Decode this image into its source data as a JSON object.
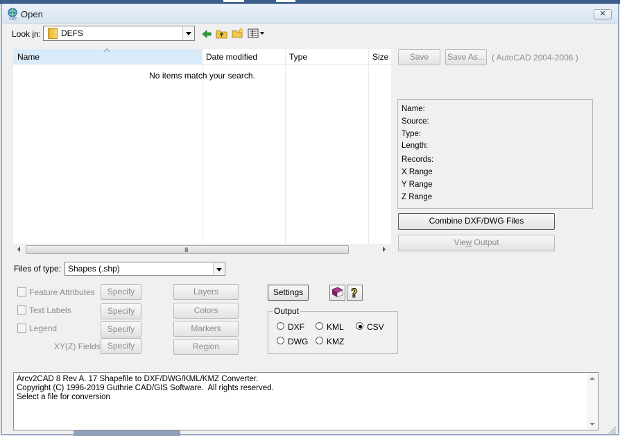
{
  "window": {
    "title": "Open",
    "close_symbol": "✕"
  },
  "look_in": {
    "label": "Look in:",
    "value": "DEFS"
  },
  "toolbar": {
    "icons": [
      "back-arrow-icon",
      "up-one-level-icon",
      "new-folder-icon",
      "view-menu-icon"
    ]
  },
  "file_list": {
    "columns": [
      "Name",
      "Date modified",
      "Type",
      "Size"
    ],
    "sorted_column": "Name",
    "empty_message": "No items match your search."
  },
  "files_of_type": {
    "label": "Files of type:",
    "value": "Shapes (.shp)"
  },
  "right_panel": {
    "save_label": "Save",
    "save_as_label": "Save As...",
    "format_text": "( AutoCAD 2004-2006 )",
    "info_labels": [
      "Name:",
      "Source:",
      "Type:",
      "Length:",
      "Records:",
      "X Range",
      "Y Range",
      "Z Range"
    ],
    "combine_label": "Combine DXF/DWG Files",
    "view_output_label": "View Output"
  },
  "options": {
    "feature_attributes": "Feature Attributes",
    "text_labels": "Text Labels",
    "legend": "Legend",
    "xyz_fields": "XY(Z) Fields:",
    "specify_label": "Specify",
    "layers_label": "Layers",
    "colors_label": "Colors",
    "markers_label": "Markers",
    "region_label": "Region",
    "settings_label": "Settings"
  },
  "output": {
    "title": "Output",
    "options": [
      "DXF",
      "KML",
      "CSV",
      "DWG",
      "KMZ"
    ],
    "selected": "CSV"
  },
  "status": {
    "lines": [
      "Arcv2CAD 8 Rev A. 17 Shapefile to DXF/DWG/KML/KMZ Converter.",
      "Copyright (C) 1996-2019 Guthrie CAD/GIS Software.  All rights reserved.",
      "Select a file for conversion"
    ]
  },
  "colors": {
    "window_bg": "#f0f0f0",
    "header_sorted": "#d9ebf9",
    "disabled_text": "#8c8c8c"
  }
}
